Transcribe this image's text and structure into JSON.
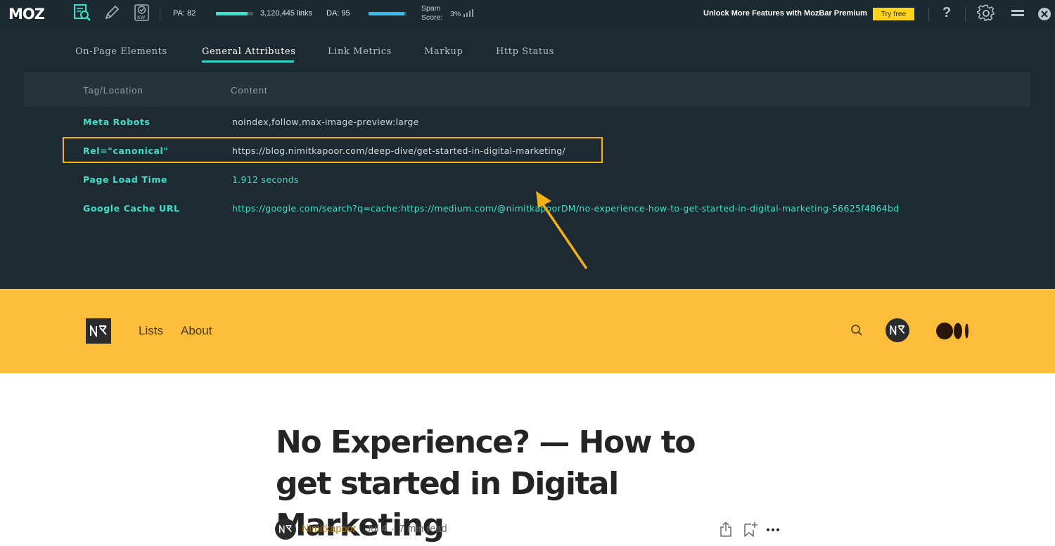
{
  "mozbar": {
    "logo": "MOZ",
    "pa_label": "PA: 82",
    "pa_fraction": 0.85,
    "links_label": "3,120,445 links",
    "da_label": "DA: 95",
    "da_fraction": 0.95,
    "spam_label_line1": "Spam",
    "spam_label_line2": "Score:",
    "spam_value": "3%",
    "unlock_text": "Unlock More Features with MozBar Premium",
    "try_free_label": "Try free",
    "help_label": "?",
    "icons": [
      "page-analysis-icon",
      "highlighter-pen-icon",
      "keyword-check-icon",
      "settings-gear-icon",
      "minimize-icon",
      "close-icon"
    ],
    "colors": {
      "bar_bg": "#1b2a30",
      "pa_bar": "#3fe0c9",
      "da_bar": "#3dbbea",
      "try_free_bg": "#ffd31a"
    }
  },
  "panel": {
    "tabs": [
      {
        "label": "On-Page Elements",
        "active": false
      },
      {
        "label": "General Attributes",
        "active": true
      },
      {
        "label": "Link Metrics",
        "active": false
      },
      {
        "label": "Markup",
        "active": false
      },
      {
        "label": "Http Status",
        "active": false
      }
    ],
    "columns": {
      "tag": "Tag/Location",
      "content": "Content"
    },
    "rows": [
      {
        "label": "Meta Robots",
        "value": "noindex,follow,max-image-preview:large"
      },
      {
        "label": "Rel=\"canonical\"",
        "value": "https://blog.nimitkapoor.com/deep-dive/get-started-in-digital-marketing/"
      },
      {
        "label": "Page Load Time",
        "value": "1.912 seconds"
      },
      {
        "label": "Google Cache URL",
        "value": "https://google.com/search?q=cache:https://medium.com/@nimitkapoorDM/no-experience-how-to-get-started-in-digital-marketing-56625f4864bd"
      }
    ],
    "colors": {
      "accent": "#3fe0c9",
      "highlight": "#f2b114"
    }
  },
  "site": {
    "logo_text": "NK",
    "nav": [
      "Lists",
      "About"
    ],
    "colors": {
      "header_bg": "#fcbd3a"
    }
  },
  "article": {
    "title": "No Experience? — How to get started in Digital Marketing",
    "author": "Nimitkapoor",
    "date": "Jul 4",
    "separator": "·",
    "read_time": "7 min read"
  }
}
